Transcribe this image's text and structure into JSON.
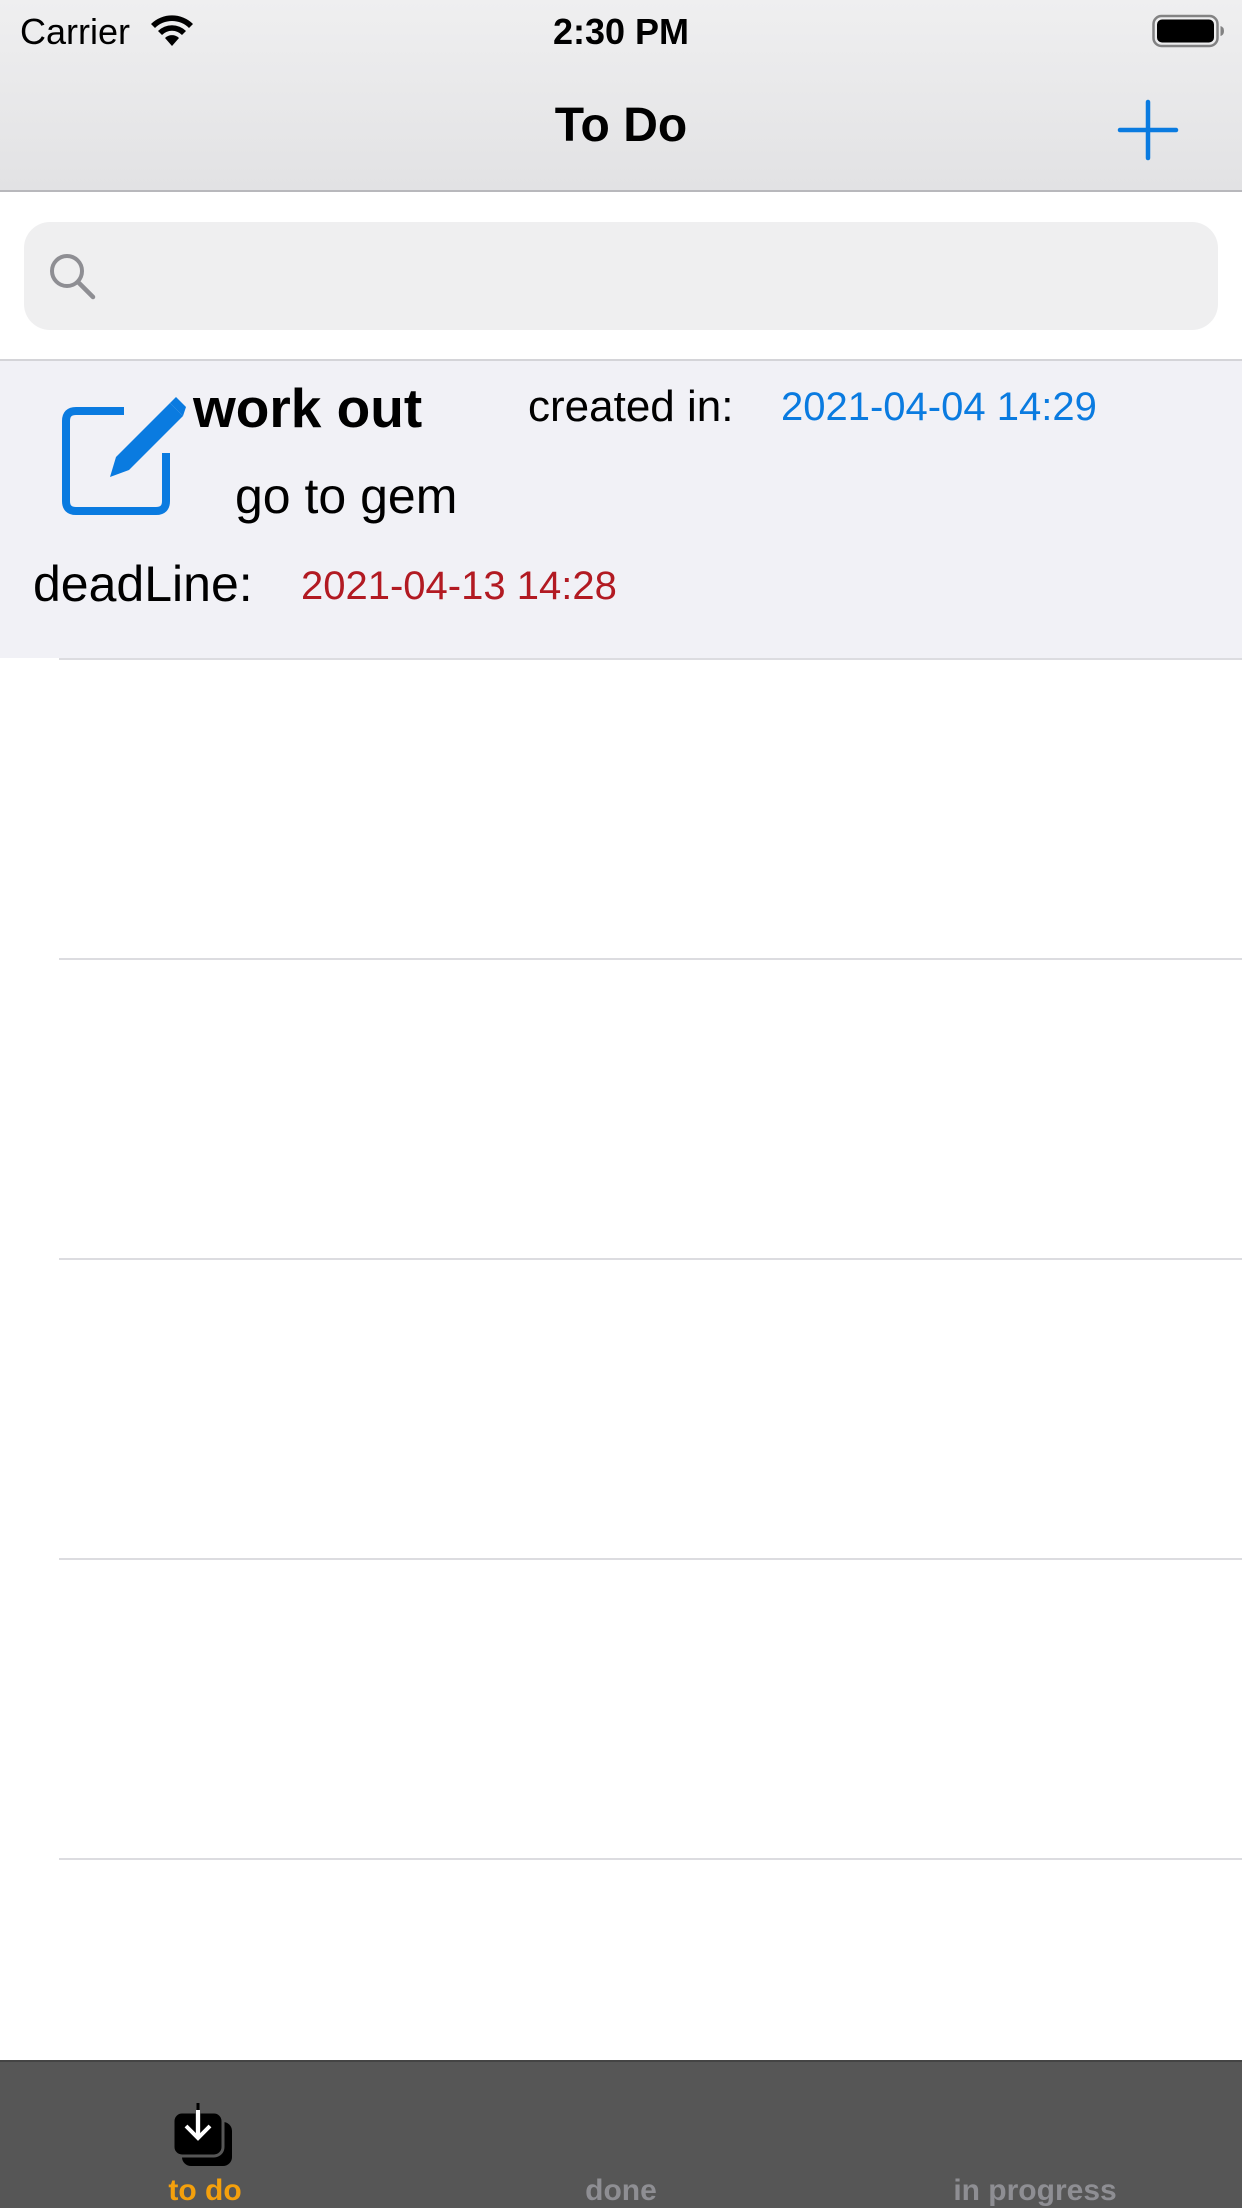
{
  "status_bar": {
    "carrier": "Carrier",
    "time": "2:30 PM",
    "wifi_icon": "wifi-icon",
    "battery_icon": "battery-icon"
  },
  "nav": {
    "title": "To Do",
    "add_icon": "plus-icon"
  },
  "search": {
    "placeholder": "",
    "value": "",
    "icon": "search-icon"
  },
  "tasks": [
    {
      "title": "work out",
      "description": "go to gem",
      "created_label": "created in:",
      "created_value": "2021-04-04 14:29",
      "deadline_label": "deadLine:",
      "deadline_value": "2021-04-13 14:28",
      "icon": "edit-icon"
    }
  ],
  "tabs": [
    {
      "label": "to do",
      "selected": true,
      "icon": "tray-download-icon"
    },
    {
      "label": "done",
      "selected": false
    },
    {
      "label": "in progress",
      "selected": false
    }
  ],
  "colors": {
    "accent_blue": "#0a7be0",
    "deadline_red": "#b21a22",
    "tab_selected": "#f4a00c",
    "tab_unselected": "#8e8e93",
    "row_background": "#f1f1f6",
    "tabbar_background": "#565656"
  }
}
